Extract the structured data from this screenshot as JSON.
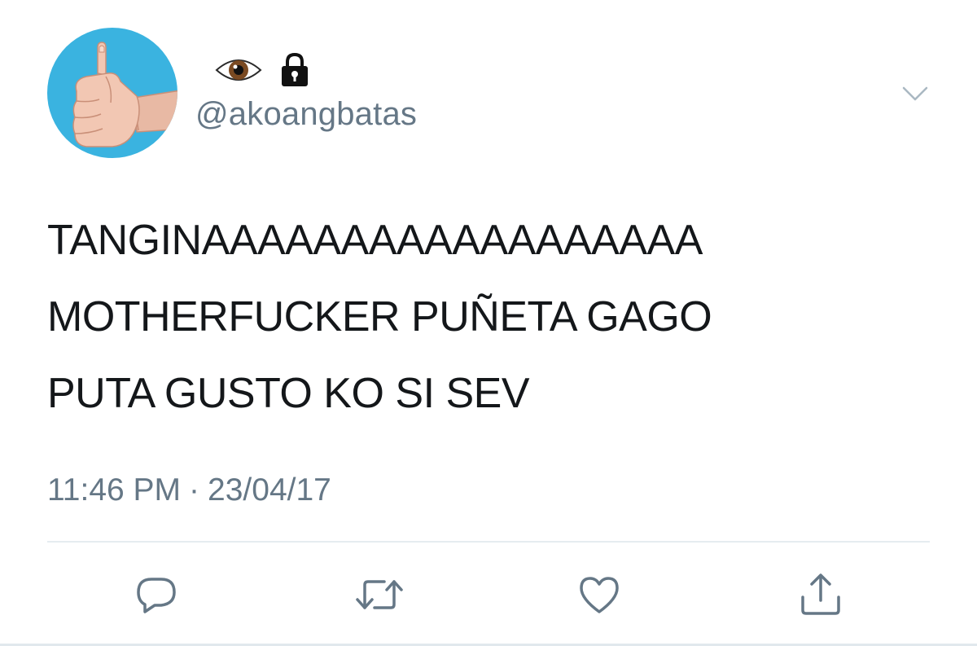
{
  "tweet": {
    "display_name_icons": [
      "eye-icon",
      "lock-icon"
    ],
    "handle": "@akoangbatas",
    "text_lines": [
      "TANGINAAAAAAAAAAAAAAAAAA",
      "MOTHERFUCKER PUÑETA GAGO",
      "PUTA GUSTO KO SI SEV"
    ],
    "time": "11:46 PM",
    "separator": "·",
    "date": "23/04/17"
  },
  "avatar": {
    "background": "#3ab3e0",
    "icon": "thumbs-up-middle-finger-icon"
  },
  "actions": {
    "icons": [
      "reply-icon",
      "retweet-icon",
      "like-icon",
      "share-icon"
    ]
  },
  "colors": {
    "text": "#14171a",
    "secondary": "#657786",
    "divider": "#e6ecf0"
  }
}
